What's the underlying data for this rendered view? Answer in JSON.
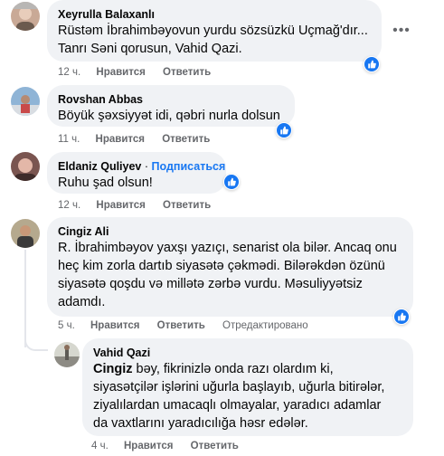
{
  "comments": [
    {
      "author": "Xeyrulla Balaxanlı",
      "lines": [
        "Rüstəm İbrahimbəyovun yurdu sözsüzkü Uçmağ'dır...",
        "Tanrı Səni qorusun, Vahid Qazi."
      ],
      "time": "12 ч.",
      "like": "Нравится",
      "reply": "Ответить"
    },
    {
      "author": "Rovshan Abbas",
      "lines": [
        "Böyük şəxsiyyət idi, qəbri nurla dolsun"
      ],
      "time": "11 ч.",
      "like": "Нравится",
      "reply": "Ответить"
    },
    {
      "author": "Eldaniz Quliyev",
      "subscribe": "Подписаться",
      "lines": [
        "Ruhu şad olsun!"
      ],
      "time": "12 ч.",
      "like": "Нравится",
      "reply": "Ответить"
    },
    {
      "author": "Cingiz Ali",
      "lines": [
        "R. İbrahimbəyov yaxşı yazıçı, senarist ola bilər. Ancaq onu",
        "heç kim zorla dartıb siyasətə çəkmədi. Bilərəkdən özünü",
        "siyasətə qoşdu və millətə zərbə vurdu. Məsuliyyətsiz",
        "adamdı."
      ],
      "time": "5 ч.",
      "like": "Нравится",
      "reply": "Ответить",
      "edited": "Отредактировано"
    },
    {
      "author": "Vahid Qazi",
      "mention": "Cingiz",
      "lines": [
        " bəy, fikrinizlə onda razı olardım ki,",
        "siyasətçilər işlərini uğurla başlayıb, uğurla bitirələr,",
        "ziyalılardan umacaqlı olmayalar, yaradıcı adamlar",
        "da vaxtlarını yaradıcılığa həsr edələr."
      ],
      "time": "4 ч.",
      "like": "Нравится",
      "reply": "Ответить"
    }
  ],
  "more_label": "•••",
  "colors": {
    "bubble": "#f0f2f5",
    "like": "#1877f2",
    "muted": "#65676b"
  }
}
